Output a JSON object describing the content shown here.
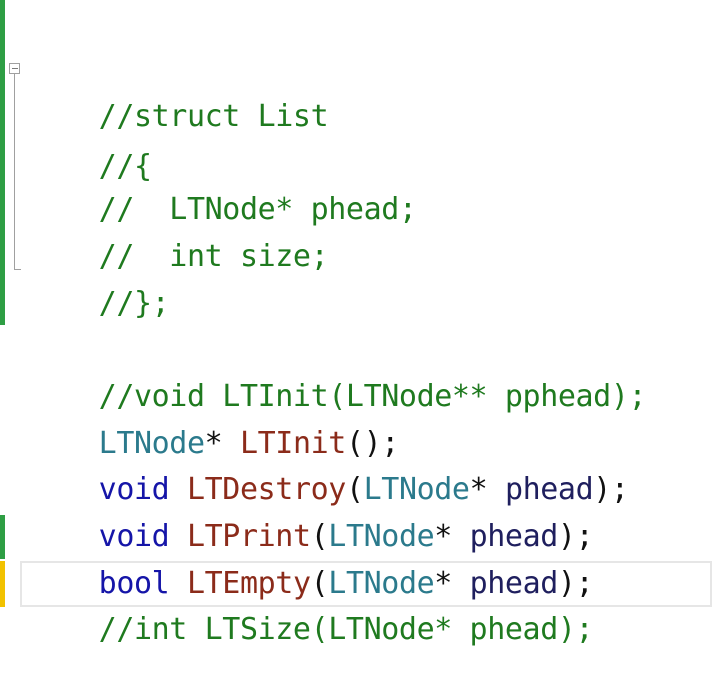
{
  "editor": {
    "lines": [
      {
        "comment": "//struct List"
      },
      {
        "comment": "//{"
      },
      {
        "comment": "//  LTNode* phead;"
      },
      {
        "comment": "//  int size;"
      },
      {
        "comment": "//};"
      },
      {
        "comment": "//void LTInit(LTNode** pphead);"
      },
      {
        "type": "LTNode",
        "p1": "* ",
        "func": "LTInit",
        "p2": "();"
      },
      {
        "kw": "void",
        "sp": " ",
        "func": "LTDestroy",
        "p1": "(",
        "type": "LTNode",
        "p2": "* ",
        "param": "phead",
        "p3": ");"
      },
      {
        "kw": "void",
        "sp": " ",
        "func": "LTPrint",
        "p1": "(",
        "type": "LTNode",
        "p2": "* ",
        "param": "phead",
        "p3": ");"
      },
      {
        "kw": "bool",
        "sp": " ",
        "func": "LTEmpty",
        "p1": "(",
        "type": "LTNode",
        "p2": "* ",
        "param": "phead",
        "p3": ");"
      },
      {
        "comment": "//int LTSize(LTNode* phead);"
      }
    ],
    "colors": {
      "comment": "#1f7a1f",
      "type": "#2b7a8c",
      "function": "#8b2b1a",
      "keyword": "#1515a8",
      "parameter": "#1f1f5e",
      "change_bar_saved": "#2e9e44",
      "change_bar_unsaved": "#f2c200"
    },
    "icons": {
      "fold": "collapse-minus-icon"
    }
  }
}
